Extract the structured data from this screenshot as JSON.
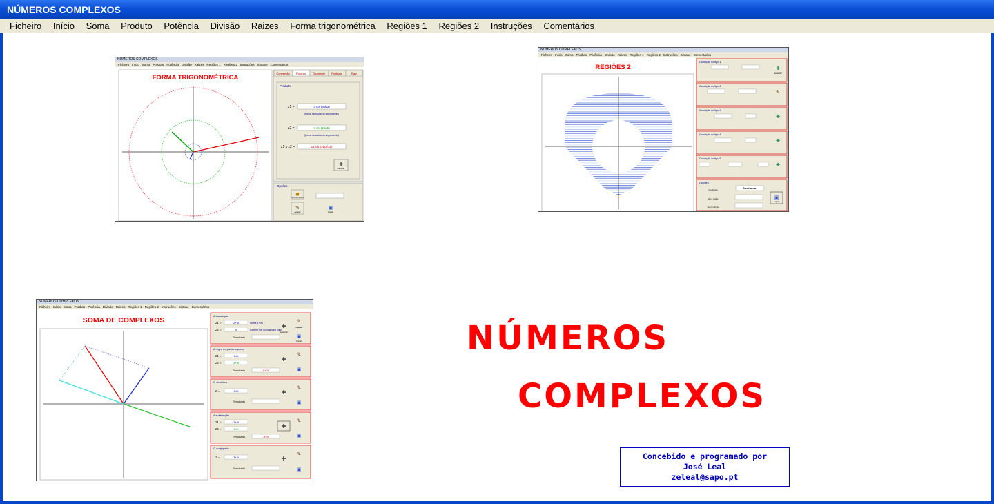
{
  "window": {
    "title": "NÚMEROS COMPLEXOS"
  },
  "menu": [
    "Ficheiro",
    "Início",
    "Soma",
    "Produto",
    "Potência",
    "Divisão",
    "Raizes",
    "Forma trigonométrica",
    "Regiões 1",
    "Regiões 2",
    "Instruções",
    "Comentários"
  ],
  "thumbs": {
    "window_title": "NÚMEROS COMPLEXOS",
    "menu": [
      "Ficheiro",
      "Início",
      "Soma",
      "Produto",
      "Potência",
      "Divisão",
      "Raizes",
      "Regiões 1",
      "Regiões 2",
      "Instruções",
      "Sintaxe",
      "Comentários"
    ],
    "trig": {
      "title": "FORMA TRIGONOMÉTRICA",
      "tabs": [
        "Conversão",
        "Produto",
        "Quociente",
        "Potência",
        "Raiz"
      ],
      "section": "Produto",
      "z1_label": "z1 =",
      "z1_value": "3 cis (4pi/3)",
      "z1_note": "(forma reduzida no seguimento)",
      "z2_label": "z2 =",
      "z2_value": "4 cis (2pi/5)",
      "z2_note": "(forma reduzida no seguimento)",
      "prod_label": "z1 x z2 =",
      "prod_value": "12 cis (26pi/15)",
      "calc": "Calcular",
      "options_title": "Opções",
      "opt1": "Ver no círculo",
      "opt2": "Apagar",
      "opt3": "Copiar"
    },
    "reg2": {
      "title": "REGIÕES 2",
      "conditions": [
        "Condição do tipo 1",
        "Condição do tipo 2",
        "Condição do tipo 3",
        "Condição do tipo 4",
        "Condição do tipo 5"
      ],
      "options_title": "Opções",
      "select_value": "Nenhuma",
      "opt1": "Conditions",
      "opt2": "Ver a região",
      "opt3": "Ver no círculo",
      "btn": "Desenhar",
      "copy": "Copiar"
    },
    "soma": {
      "title": "SOMA DE COMPLEXOS",
      "sections": [
        "A translação",
        "A regra do paralelogramo",
        "O simétrico",
        "A subtracção",
        "O conjugado"
      ],
      "z1": "z1 =",
      "z2": "z2 =",
      "z": "z =",
      "v1": "2+3i",
      "v2": "3i",
      "v3": "5-2i",
      "v4": "3+4i",
      "v5": "5-2i",
      "v6": "2+3i",
      "v7": "5-2i",
      "v8": "3+2i",
      "note1": "(forma a + bi)",
      "note2": "(número real ou imaginário puro)",
      "result": "Resultado",
      "r2": "8+2i",
      "r4": "-3+5i",
      "draw": "Desenhar",
      "erase": "Apagar",
      "copy": "Copiar"
    }
  },
  "hero": {
    "line1": "NÚMEROS",
    "line2": "COMPLEXOS"
  },
  "credit": {
    "line1": "Concebido e programado por",
    "line2": "José Leal",
    "line3": "zeleal@sapo.pt"
  },
  "colors": {
    "accent": "#ff0000",
    "titlebar": "#0a4fd6",
    "credit": "#0000c0"
  }
}
